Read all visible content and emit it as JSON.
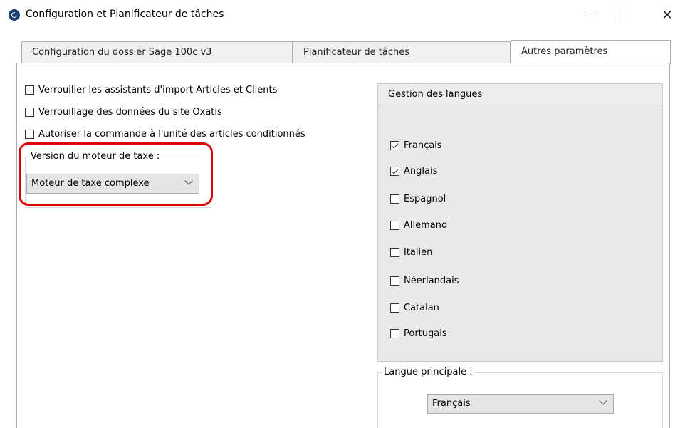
{
  "window": {
    "title": "Configuration et Planificateur de tâches",
    "minimize": "—",
    "close": "✕"
  },
  "tabs": [
    {
      "label": "Configuration du dossier Sage 100c v3",
      "active": false
    },
    {
      "label": "Planificateur de tâches",
      "active": false
    },
    {
      "label": "Autres paramètres",
      "active": true
    }
  ],
  "options": {
    "lock_import": {
      "label": "Verrouiller les assistants d'import Articles et Clients",
      "checked": false
    },
    "lock_site": {
      "label": "Verrouillage des données du site Oxatis",
      "checked": false
    },
    "allow_unit": {
      "label": "Autoriser la commande à l'unité des articles conditionnés",
      "checked": false
    }
  },
  "tax_engine": {
    "legend": "Version du moteur de taxe :",
    "selected": "Moteur de taxe complexe"
  },
  "languages": {
    "header": "Gestion des langues",
    "items": [
      {
        "label": "Français",
        "checked": true
      },
      {
        "label": "Anglais",
        "checked": true
      },
      {
        "label": "Espagnol",
        "checked": false
      },
      {
        "label": "Allemand",
        "checked": false
      },
      {
        "label": "Italien",
        "checked": false
      },
      {
        "label": "Néerlandais",
        "checked": false
      },
      {
        "label": "Catalan",
        "checked": false
      },
      {
        "label": "Portugais",
        "checked": false
      }
    ]
  },
  "main_language": {
    "legend": "Langue principale :",
    "selected": "Français"
  },
  "colors": {
    "highlight": "#e10000",
    "panel_bg": "#e9e9e9",
    "app_icon": "#1f3f77"
  }
}
